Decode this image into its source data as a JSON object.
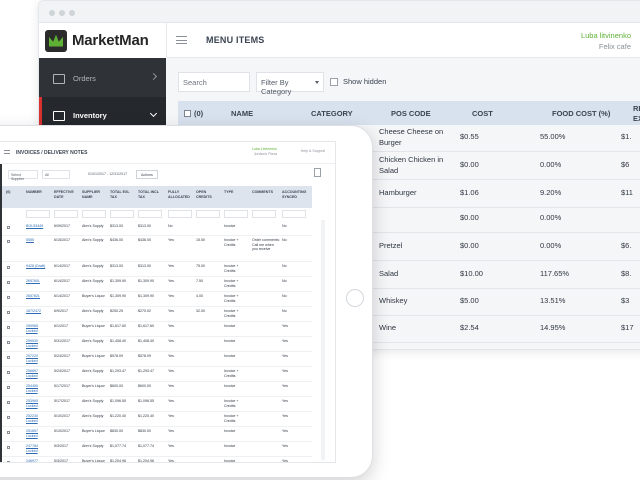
{
  "browser": {
    "logo_text": "MarketMan",
    "page_title": "MENU ITEMS",
    "user_name": "Luba litvinenko",
    "venue": "Felix cafe",
    "sidebar": [
      {
        "label": "Orders",
        "active": false
      },
      {
        "label": "Inventory",
        "active": true
      }
    ],
    "search_placeholder": "Search",
    "filter_label": "Filter By Category",
    "show_hidden_label": "Show hidden",
    "headers": {
      "select": "(0)",
      "name": "NAME",
      "category": "CATEGORY",
      "pos_code": "POS CODE",
      "cost": "COST",
      "food_cost": "FOOD COST (%)",
      "re": "RE",
      "ex": "EX"
    },
    "rows": [
      {
        "pos": "Cheese Cheese on",
        "pos2": "Burger",
        "cost": "$0.55",
        "food": "55.00%",
        "re": "$1."
      },
      {
        "pos": "Chicken Chicken in",
        "pos2": "Salad",
        "cost": "$0.00",
        "food": "0.00%",
        "re": "$6"
      },
      {
        "pos": "Hamburger",
        "pos2": "",
        "cost": "$1.06",
        "food": "9.20%",
        "re": "$11"
      },
      {
        "pos": "",
        "pos2": "",
        "cost": "$0.00",
        "food": "0.00%",
        "re": ""
      },
      {
        "pos": "Pretzel",
        "pos2": "",
        "cost": "$0.00",
        "food": "0.00%",
        "re": "$6."
      },
      {
        "pos": "Salad",
        "pos2": "",
        "cost": "$10.00",
        "food": "117.65%",
        "re": "$8."
      },
      {
        "pos": "Whiskey",
        "pos2": "",
        "cost": "$5.00",
        "food": "13.51%",
        "re": "$3"
      },
      {
        "pos": "Wine",
        "pos2": "",
        "cost": "$2.54",
        "food": "14.95%",
        "re": "$17"
      }
    ]
  },
  "tablet": {
    "brand_fragment": "an",
    "title": "INVOICES / DELIVERY NOTES",
    "user_name": "Luba Litvinenko",
    "venue": "Jordan's Pizza",
    "help": "Help & Support",
    "filter_supplier": "Select Supplier",
    "filter_all": "All",
    "date_range": "01/01/2017 - 12/31/2017",
    "actions_label": "Actions",
    "headers": [
      "(0)",
      "NUMBER",
      "EFFECTIVE DATE",
      "SUPPLIER NAME",
      "TOTAL EXL TAX",
      "TOTAL INCL TAX",
      "FULLY ALLOCATED",
      "OPEN CREDITS",
      "TYPE",
      "COMMENTS",
      "ACCOUNTING SYNCED"
    ],
    "rows": [
      {
        "num": "BOL53449",
        "date": "6/09/2017",
        "sup": "Alex's Supply",
        "ex": "$313.00",
        "inc": "$313.00",
        "fa": "No",
        "oc": "",
        "type": "Invoice",
        "com": "",
        "acc": "No"
      },
      {
        "num": "5555",
        "date": "6/15/2017",
        "sup": "Alex's Supply",
        "ex": "$436.00",
        "inc": "$436.00",
        "fa": "Yes",
        "oc": "15.50",
        "type": "Invoice + Credits",
        "com": "Order comments: Call me when you receive",
        "acc": "No"
      },
      {
        "num": "9428 (Draft)",
        "date": "6/14/2017",
        "sup": "Alex's Supply",
        "ex": "$313.00",
        "inc": "$313.00",
        "fa": "Yes",
        "oc": "75.00",
        "type": "Invoice + Credits",
        "com": "",
        "acc": "No"
      },
      {
        "num": "265760L",
        "date": "6/14/2017",
        "sup": "Alex's Supply",
        "ex": "$1,309.90",
        "inc": "$1,309.90",
        "fa": "Yes",
        "oc": "7.50",
        "type": "Invoice + Credits",
        "com": "",
        "acc": "No"
      },
      {
        "num": "265782L",
        "date": "6/14/2017",
        "sup": "Buyer's Liquor",
        "ex": "$1,309.90",
        "inc": "$1,309.90",
        "fa": "Yes",
        "oc": "4.00",
        "type": "Invoice + Credits",
        "com": "",
        "acc": "No"
      },
      {
        "num": "167/2472",
        "date": "6/9/2017",
        "sup": "Alex's Supply",
        "ex": "$250.25",
        "inc": "$270.02",
        "fa": "Yes",
        "oc": "32.00",
        "type": "Invoice + Credits",
        "com": "",
        "acc": "No"
      },
      {
        "num": "259965 Locked",
        "date": "6/1/2017",
        "sup": "Buyer's Liquor",
        "ex": "$1,617.60",
        "inc": "$1,617.60",
        "fa": "Yes",
        "oc": "",
        "type": "Invoice",
        "com": "",
        "acc": "Yes"
      },
      {
        "num": "259530 Locked",
        "date": "5/31/2017",
        "sup": "Alex's Supply",
        "ex": "$1,408.40",
        "inc": "$1,408.40",
        "fa": "Yes",
        "oc": "",
        "type": "Invoice",
        "com": "",
        "acc": "Yes"
      },
      {
        "num": "257220 Locked",
        "date": "5/24/2017",
        "sup": "Buyer's Liquor",
        "ex": "$578.09",
        "inc": "$578.09",
        "fa": "Yes",
        "oc": "",
        "type": "Invoice",
        "com": "",
        "acc": "Yes"
      },
      {
        "num": "256897 Locked",
        "date": "5/24/2017",
        "sup": "Alex's Supply",
        "ex": "$1,293.47",
        "inc": "$1,293.47",
        "fa": "Yes",
        "oc": "",
        "type": "Invoice + Credits",
        "com": "",
        "acc": "Yes"
      },
      {
        "num": "254450 Locked",
        "date": "5/17/2017",
        "sup": "Buyer's Liquor",
        "ex": "$600.00",
        "inc": "$600.00",
        "fa": "Yes",
        "oc": "",
        "type": "Invoice",
        "com": "",
        "acc": "Yes"
      },
      {
        "num": "253965 Locked",
        "date": "5/17/2017",
        "sup": "Alex's Supply",
        "ex": "$1,096.55",
        "inc": "$1,096.55",
        "fa": "Yes",
        "oc": "",
        "type": "Invoice + Credits",
        "com": "",
        "acc": "Yes"
      },
      {
        "num": "252230 Locked",
        "date": "5/10/2017",
        "sup": "Alex's Supply",
        "ex": "$1,220.40",
        "inc": "$1,220.40",
        "fa": "Yes",
        "oc": "",
        "type": "Invoice + Credits",
        "com": "",
        "acc": "Yes"
      },
      {
        "num": "251657 Locked",
        "date": "5/10/2017",
        "sup": "Buyer's Liquor",
        "ex": "$830.00",
        "inc": "$830.00",
        "fa": "Yes",
        "oc": "",
        "type": "Invoice",
        "com": "",
        "acc": "Yes"
      },
      {
        "num": "247784 Locked",
        "date": "5/3/2017",
        "sup": "Alex's Supply",
        "ex": "$1,077.74",
        "inc": "$1,077.74",
        "fa": "Yes",
        "oc": "",
        "type": "Invoice",
        "com": "",
        "acc": "Yes"
      },
      {
        "num": "246977 Locked",
        "date": "5/3/2017",
        "sup": "Buyer's Liquor",
        "ex": "$1,204.96",
        "inc": "$1,204.96",
        "fa": "Yes",
        "oc": "",
        "type": "Invoice",
        "com": "",
        "acc": "Yes"
      }
    ]
  },
  "colors": {
    "brand_green": "#5fb136",
    "sidebar_dark": "#2f3338",
    "active_red": "#d6322f",
    "table_header": "#d8e1ee",
    "link_blue": "#2d6cb3"
  }
}
